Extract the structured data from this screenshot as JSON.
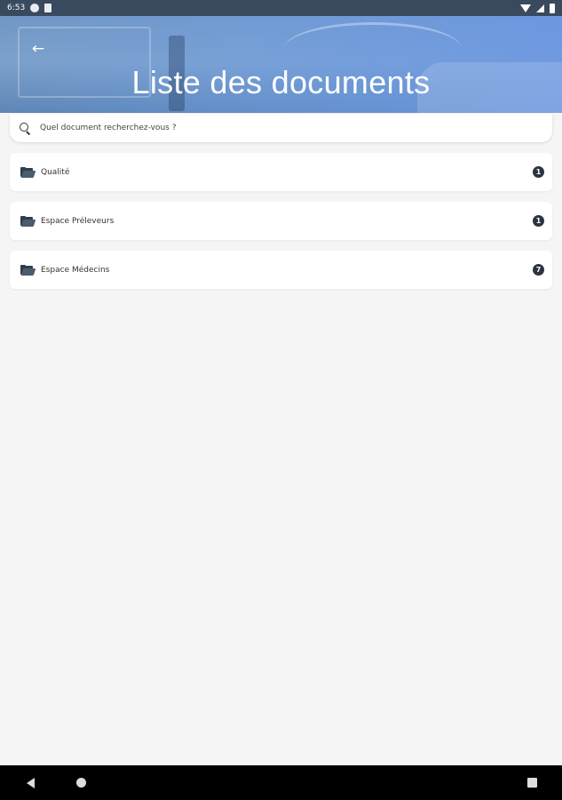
{
  "status_bar": {
    "time": "6:53",
    "icons": [
      "app-notification-icon",
      "sd-card-icon",
      "wifi-icon",
      "signal-icon",
      "battery-icon"
    ]
  },
  "header": {
    "title": "Liste des documents",
    "back_icon": "arrow-back-icon"
  },
  "search": {
    "placeholder": "Quel document recherchez-vous ?"
  },
  "folders": [
    {
      "label": "Qualité",
      "count": "1",
      "icon": "folder-open-icon"
    },
    {
      "label": "Espace Préleveurs",
      "count": "1",
      "icon": "folder-open-icon"
    },
    {
      "label": "Espace Médecins",
      "count": "7",
      "icon": "folder-open-icon"
    }
  ],
  "colors": {
    "background": "#f5f5f5",
    "header_blue": "#6996e1",
    "badge": "#2b3440",
    "card": "#ffffff"
  },
  "nav_bar": {
    "buttons": [
      "nav-back-icon",
      "nav-home-icon",
      "nav-recents-icon"
    ]
  }
}
